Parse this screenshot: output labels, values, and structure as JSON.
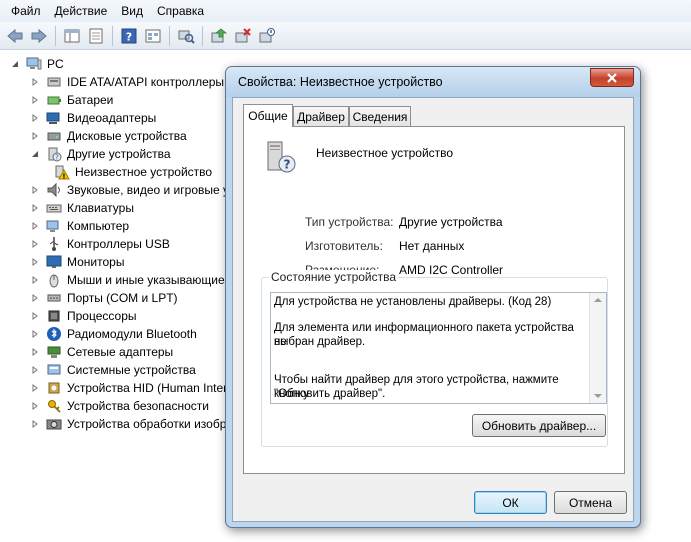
{
  "menu": [
    "Файл",
    "Действие",
    "Вид",
    "Справка"
  ],
  "toolbar_icons": [
    "back-arrow-icon",
    "forward-arrow-icon",
    "show-hide-tree-icon",
    "properties-icon",
    "help-icon",
    "view-icon",
    "scan-hardware-icon",
    "update-driver-icon",
    "uninstall-icon",
    "disable-device-icon"
  ],
  "tree": {
    "root": "PC",
    "items": [
      {
        "label": "IDE ATA/ATAPI контроллеры",
        "icon": "ide-controller-icon"
      },
      {
        "label": "Батареи",
        "icon": "battery-icon"
      },
      {
        "label": "Видеоадаптеры",
        "icon": "display-adapter-icon"
      },
      {
        "label": "Дисковые устройства",
        "icon": "disk-drive-icon"
      },
      {
        "label": "Другие устройства",
        "icon": "other-devices-icon",
        "expanded": true
      },
      {
        "label": "Неизвестное устройство",
        "icon": "unknown-device-warning-icon",
        "child": true
      },
      {
        "label": "Звуковые, видео и игровые устройства",
        "icon": "sound-icon"
      },
      {
        "label": "Клавиатуры",
        "icon": "keyboard-icon"
      },
      {
        "label": "Компьютер",
        "icon": "computer-icon"
      },
      {
        "label": "Контроллеры USB",
        "icon": "usb-icon"
      },
      {
        "label": "Мониторы",
        "icon": "monitor-icon"
      },
      {
        "label": "Мыши и иные указывающие устройства",
        "icon": "mouse-icon"
      },
      {
        "label": "Порты (COM и LPT)",
        "icon": "port-icon"
      },
      {
        "label": "Процессоры",
        "icon": "processor-icon"
      },
      {
        "label": "Радиомодули Bluetooth",
        "icon": "bluetooth-icon"
      },
      {
        "label": "Сетевые адаптеры",
        "icon": "network-adapter-icon"
      },
      {
        "label": "Системные устройства",
        "icon": "system-devices-icon"
      },
      {
        "label": "Устройства HID (Human Interface Devices)",
        "icon": "hid-icon"
      },
      {
        "label": "Устройства безопасности",
        "icon": "security-key-icon"
      },
      {
        "label": "Устройства обработки изображений",
        "icon": "imaging-device-icon"
      }
    ]
  },
  "dialog": {
    "title": "Свойства: Неизвестное устройство",
    "tabs": [
      "Общие",
      "Драйвер",
      "Сведения"
    ],
    "device_name": "Неизвестное устройство",
    "properties": [
      {
        "label": "Тип устройства:",
        "value": "Другие устройства"
      },
      {
        "label": "Изготовитель:",
        "value": "Нет данных"
      },
      {
        "label": "Размещение:",
        "value": "AMD I2C Controller"
      }
    ],
    "status_group_title": "Состояние устройства",
    "status_lines": [
      "Для устройства не установлены драйверы. (Код 28)",
      "Для элемента или информационного пакета устройства не",
      "выбран драйвер.",
      "Чтобы найти драйвер для этого устройства, нажмите кнопку",
      "\"Обновить драйвер\"."
    ],
    "update_button": "Обновить драйвер...",
    "ok_button": "ОК",
    "cancel_button": "Отмена"
  },
  "colors": {
    "warning": "#f5c400",
    "close_button": "#c5412a",
    "accent_border": "#3c7fb1"
  }
}
